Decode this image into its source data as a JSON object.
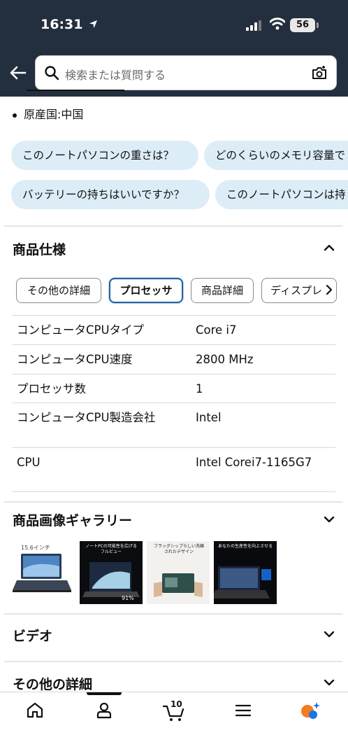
{
  "status_bar": {
    "time": "16:31",
    "battery": "56"
  },
  "search": {
    "placeholder": "検索または質問する"
  },
  "product_bullets": {
    "origin": "原産国:中国"
  },
  "question_chips": [
    "このノートパソコンの重さは？",
    "どのくらいのメモリ容量で",
    "バッテリーの持ちはいいですか？",
    "このノートパソコンは持"
  ],
  "spec_section": {
    "title": "商品仕様",
    "tabs": [
      "その他の詳細",
      "プロセッサ",
      "商品詳細",
      "ディスプレ"
    ],
    "active_tab": "プロセッサ",
    "rows": [
      {
        "key": "コンピュータCPUタイプ",
        "value": "Core i7"
      },
      {
        "key": "コンピュータCPU速度",
        "value": "2800 MHz"
      },
      {
        "key": "プロセッサ数",
        "value": "1"
      },
      {
        "key": "コンピュータCPU製造会社",
        "value": "Intel"
      },
      {
        "key": "CPU",
        "value": "Intel Corei7-1165G7"
      }
    ]
  },
  "gallery_section": {
    "title": "商品画像ギャラリー",
    "images": [
      {
        "caption": "15.6インチ"
      },
      {
        "caption": "ノートPCの可能性を広げるフルビュー"
      },
      {
        "caption": "フラッグシップらしい洗練されたデザイン"
      },
      {
        "caption": "あなたの生産性を向上させる"
      }
    ]
  },
  "video_section": {
    "title": "ビデオ"
  },
  "other_section": {
    "title": "その他の詳細"
  },
  "bottom_nav": {
    "cart_count": "10"
  },
  "colors": {
    "header_bg": "#232f3e",
    "chip_bg": "#dcedf8",
    "active_tab_border": "#2162a1",
    "assistant_orange": "#f47b20",
    "assistant_blue": "#1a73e8"
  }
}
